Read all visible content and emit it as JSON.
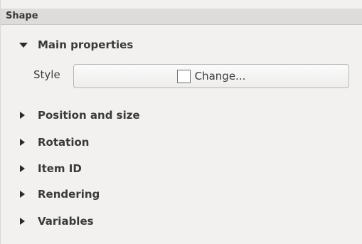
{
  "panel": {
    "title": "Shape"
  },
  "main_properties": {
    "label": "Main properties",
    "expanded": true,
    "style_label": "Style",
    "style_button_label": "Change..."
  },
  "sections": [
    {
      "label": "Position and size",
      "expanded": false
    },
    {
      "label": "Rotation",
      "expanded": false
    },
    {
      "label": "Item ID",
      "expanded": false
    },
    {
      "label": "Rendering",
      "expanded": false
    },
    {
      "label": "Variables",
      "expanded": false
    }
  ]
}
